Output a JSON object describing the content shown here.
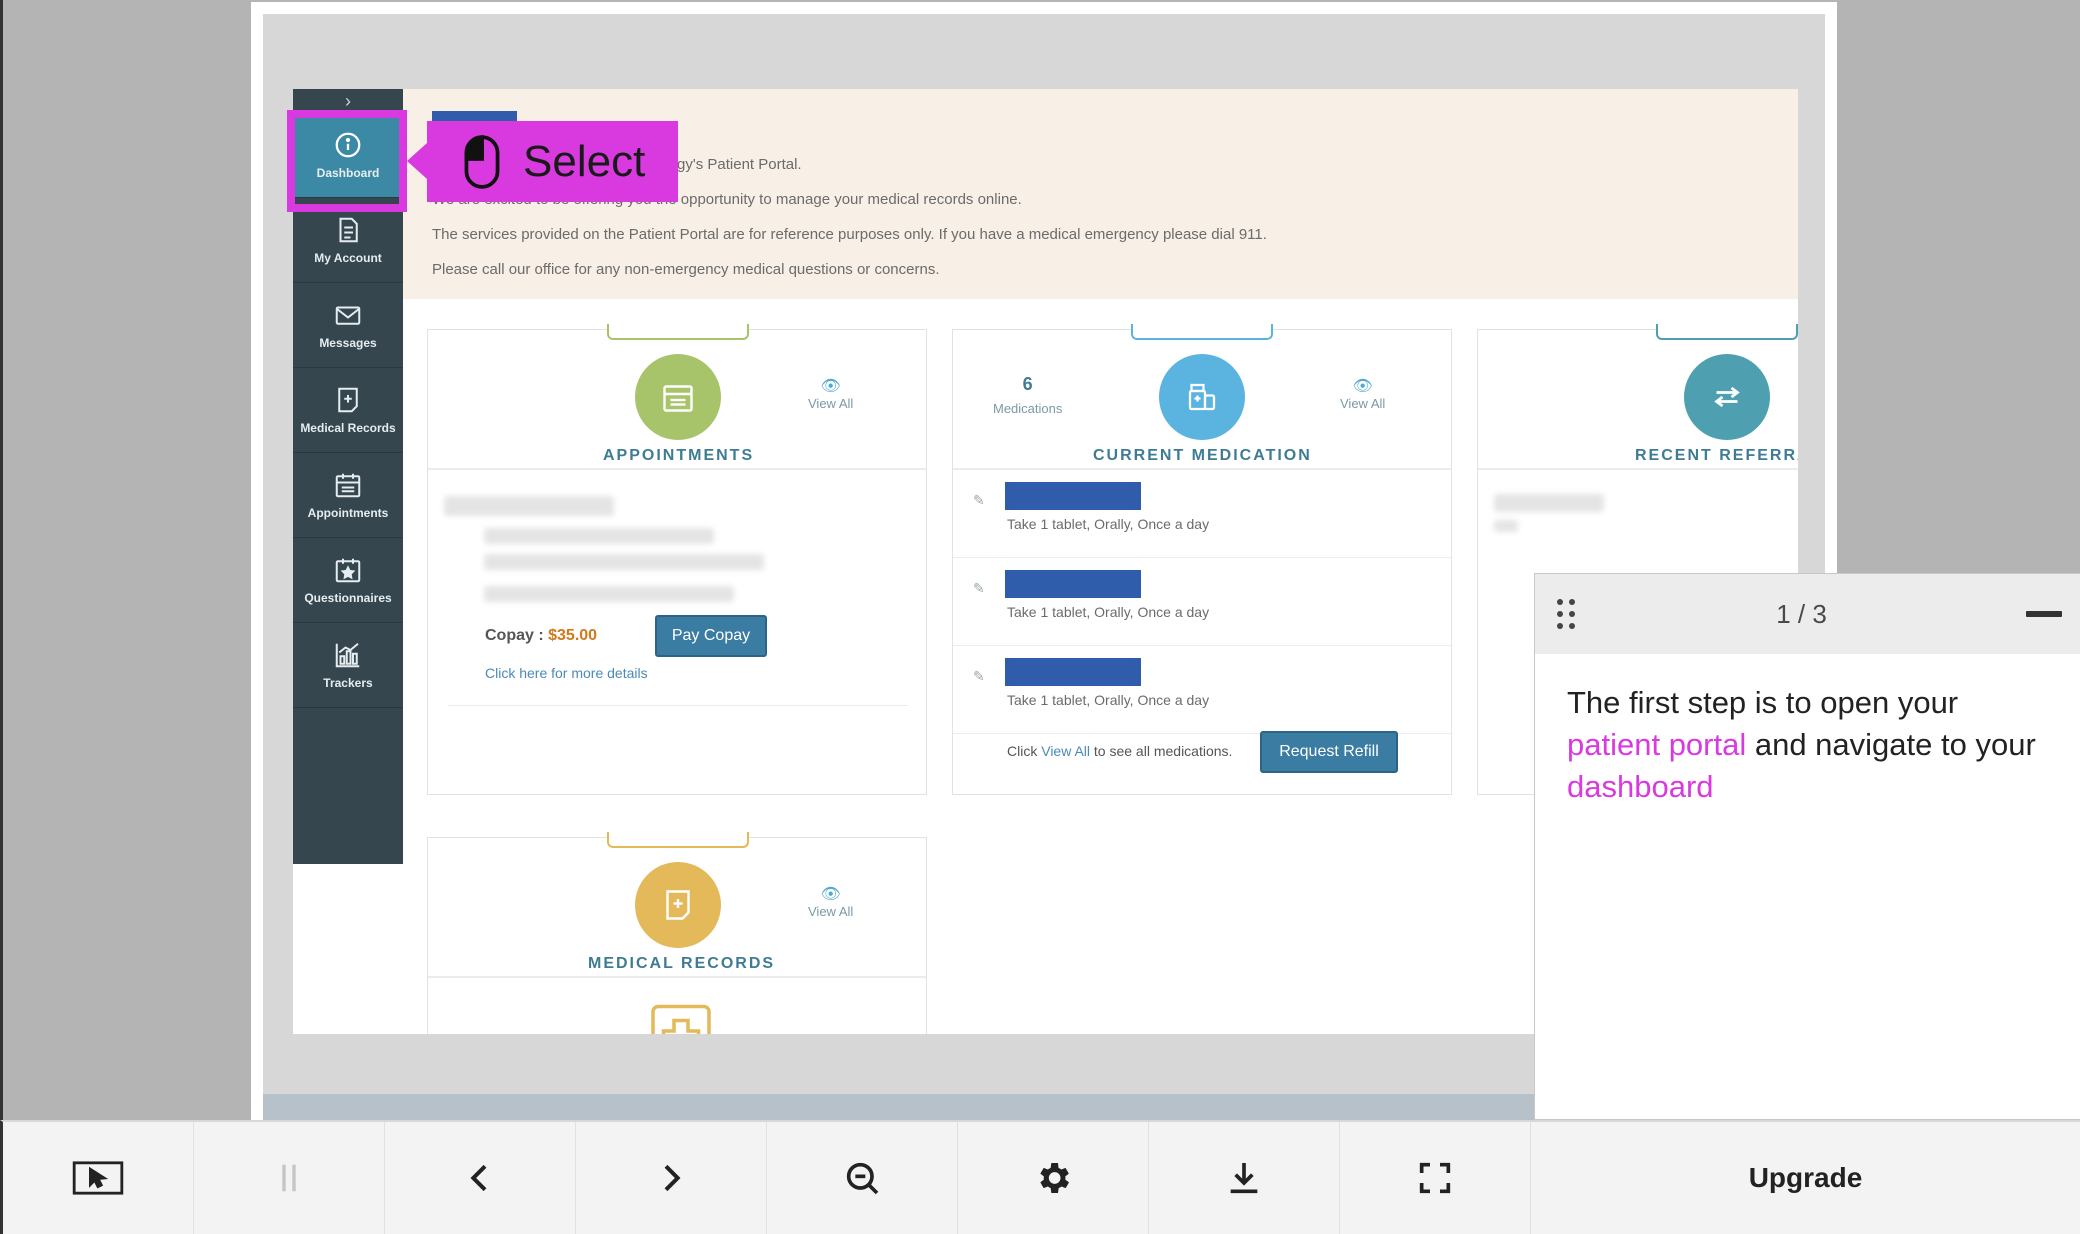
{
  "sidebar": {
    "collapse_glyph": "›",
    "items": [
      {
        "label": "Dashboard",
        "icon": "info-icon"
      },
      {
        "label": "My Account",
        "icon": "document-icon"
      },
      {
        "label": "Messages",
        "icon": "envelope-icon"
      },
      {
        "label": "Medical Records",
        "icon": "record-icon"
      },
      {
        "label": "Appointments",
        "icon": "calendar-icon"
      },
      {
        "label": "Questionnaires",
        "icon": "calendar-star-icon"
      },
      {
        "label": "Trackers",
        "icon": "chart-icon"
      }
    ]
  },
  "banner": {
    "lines": [
      "gy's Patient Portal.",
      "We are excited to be offering you the opportunity to manage your medical records online.",
      "The services provided on the Patient Portal are for reference purposes only.  If you have a medical emergency please dial 911.",
      "Please call our office for any non-emergency medical questions or concerns."
    ]
  },
  "cards": {
    "appointments": {
      "title": "APPOINTMENTS",
      "view_all": "View All",
      "copay_label": "Copay : ",
      "copay_value": "$35.00",
      "pay_button": "Pay Copay",
      "details_link": "Click here for more details"
    },
    "medication": {
      "count": "6",
      "count_label": "Medications",
      "title": "CURRENT MEDICATION",
      "view_all": "View All",
      "rows": [
        {
          "sig": "Take 1 tablet, Orally, Once a day"
        },
        {
          "sig": "Take 1 tablet, Orally, Once a day"
        },
        {
          "sig": "Take 1 tablet, Orally, Once a day"
        }
      ],
      "footer_pre": "Click ",
      "footer_link": "View All",
      "footer_post": " to see all medications.",
      "refill_button": "Request Refill"
    },
    "referrals": {
      "title": "RECENT REFERRA"
    },
    "records": {
      "title": "MEDICAL RECORDS",
      "view_all": "View All"
    }
  },
  "callout": {
    "label": "Select",
    "icon": "mouse-icon"
  },
  "guide": {
    "counter": "1 / 3",
    "text_1": "The first step is to open your ",
    "highlight_1": "patient portal",
    "text_2": " and navigate to your ",
    "highlight_2": "dashboard"
  },
  "toolbar": {
    "items": [
      {
        "name": "screen-pointer-icon"
      },
      {
        "name": "pause-icon"
      },
      {
        "name": "previous-icon"
      },
      {
        "name": "next-icon"
      },
      {
        "name": "zoom-out-icon"
      },
      {
        "name": "settings-icon"
      },
      {
        "name": "download-icon"
      },
      {
        "name": "fullscreen-icon"
      }
    ],
    "upgrade_label": "Upgrade"
  },
  "colors": {
    "accent": "#d93ae0",
    "sidebar": "#35464f",
    "active": "#3c89a6",
    "appointments": "#a8c46a",
    "medication": "#5bb4df",
    "referrals": "#4e9fb0",
    "records": "#e4b95a",
    "copay": "#d07a1a"
  }
}
